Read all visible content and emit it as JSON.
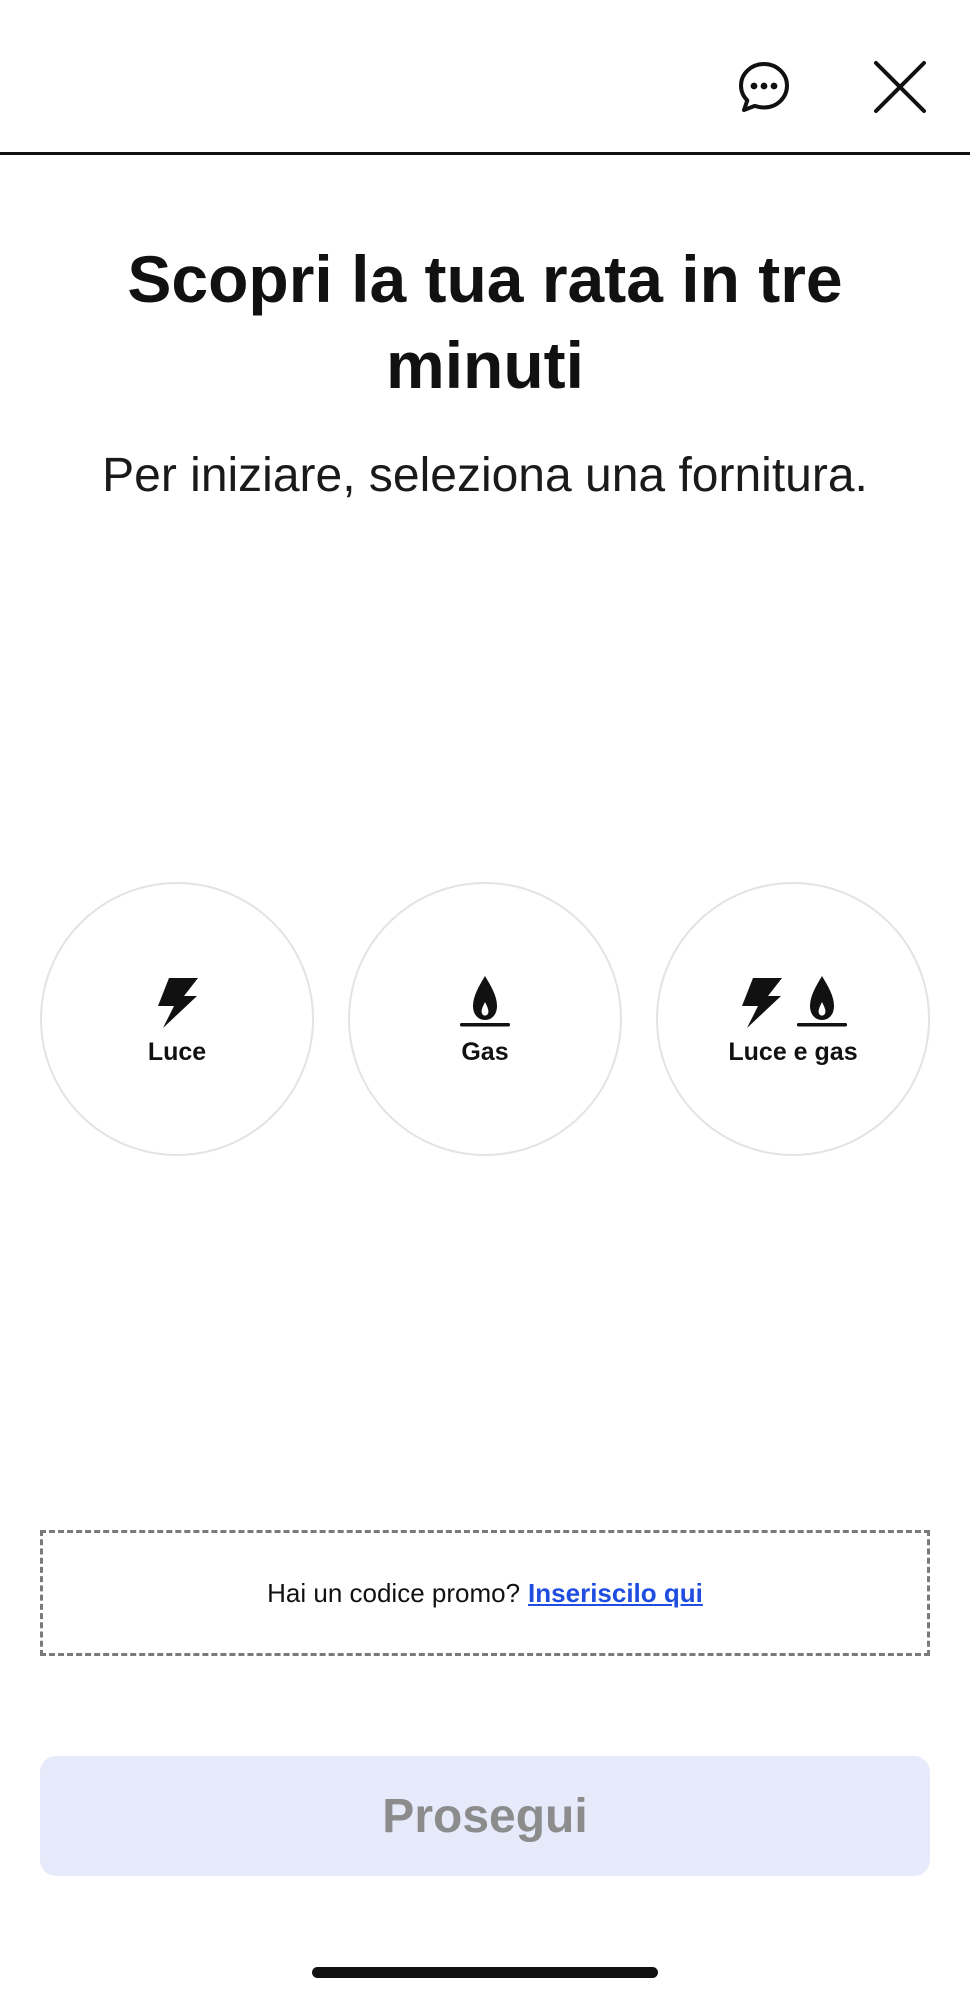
{
  "header": {
    "chat_icon": "chat-bubble-dots-icon",
    "close_icon": "close-x-icon"
  },
  "main": {
    "title": "Scopri la tua rata in tre minuti",
    "subtitle": "Per iniziare, seleziona una fornitura."
  },
  "options": [
    {
      "label": "Luce",
      "icons": [
        "lightning-icon"
      ]
    },
    {
      "label": "Gas",
      "icons": [
        "flame-icon"
      ]
    },
    {
      "label": "Luce e gas",
      "icons": [
        "lightning-icon",
        "flame-icon"
      ]
    }
  ],
  "promo": {
    "text": "Hai un codice promo?",
    "link": "Inseriscilo qui",
    "link_color": "#1f4de0"
  },
  "footer": {
    "continue_label": "Prosegui",
    "continue_bg": "#e6eafb",
    "continue_text_color": "#8c8c8c"
  }
}
